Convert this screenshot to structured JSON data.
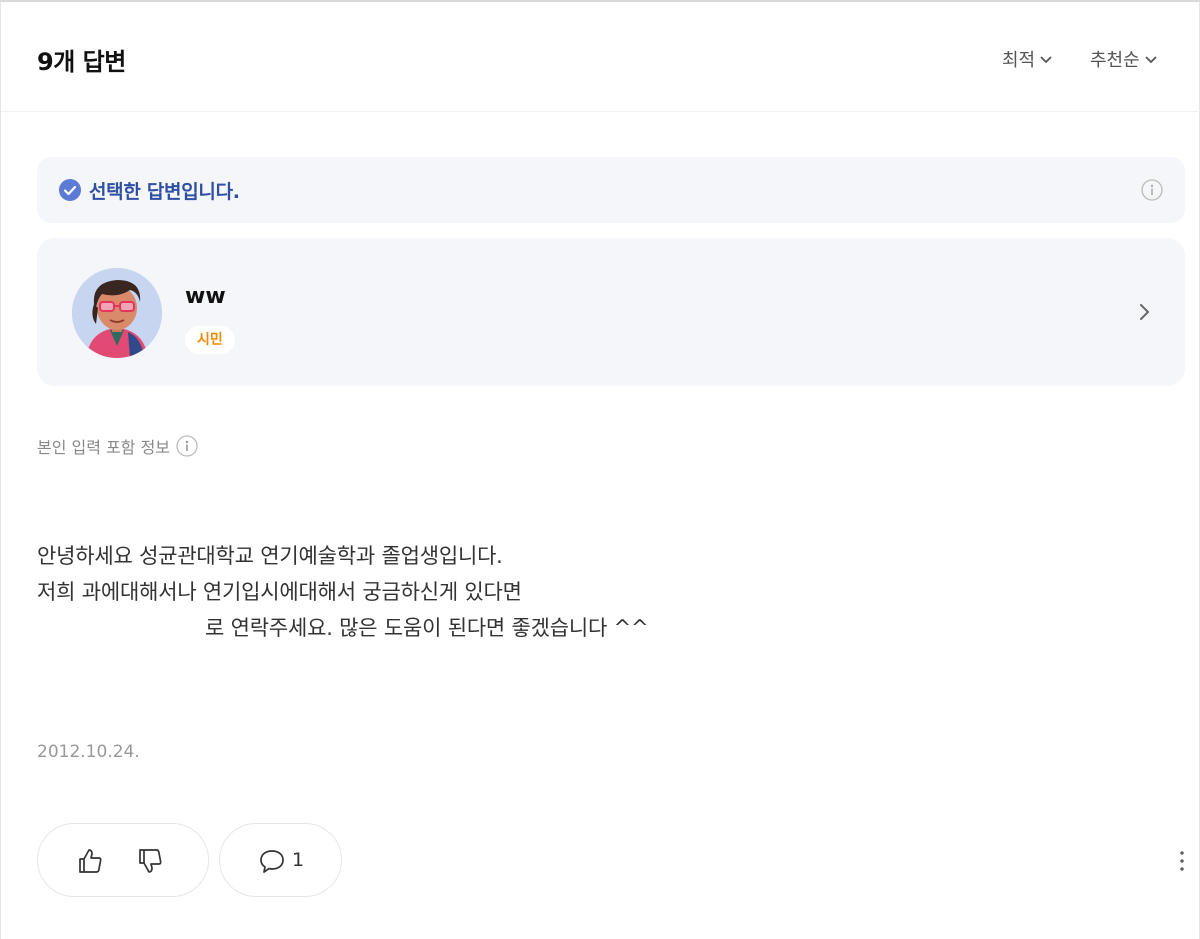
{
  "header": {
    "title": "9개 답변",
    "sort_latest": "최적",
    "sort_recommended": "추천순"
  },
  "selected": {
    "label": "선택한 답변입니다.",
    "accent_color": "#2f4ea5"
  },
  "profile": {
    "username": "ww",
    "grade": "시민"
  },
  "owner_info_label": "본인 입력 포함 정보",
  "answer": {
    "lines": [
      "안녕하세요 성균관대학교 연기예술학과 졸업생입니다.",
      "저희 과에대해서나 연기입시에대해서 궁금하신게 있다면",
      "로 연락주세요. 많은 도움이 된다면 좋겠습니다 ^^"
    ],
    "date": "2012.10.24."
  },
  "actions": {
    "comment_count": "1"
  },
  "icons": {
    "check": "check-circle-icon",
    "info": "info-icon",
    "chevron": "chevron-right-icon",
    "thumb_up": "thumbs-up-icon",
    "thumb_down": "thumbs-down-icon",
    "comment": "comment-icon",
    "more": "more-vertical-icon"
  }
}
